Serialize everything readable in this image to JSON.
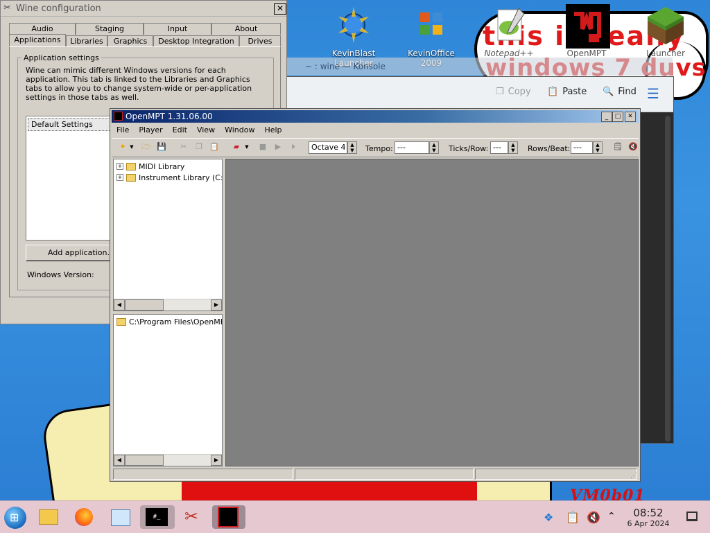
{
  "desktop": {
    "graffiti_top": "this is really",
    "graffiti_bottom": "windows 7 duvs",
    "corner_text": "VM0b01",
    "icons": [
      {
        "name": "KevinBlast Launcher",
        "label": "KevinBlast Launcher"
      },
      {
        "name": "KevinOffice 2009",
        "label": "KevinOffice 2009"
      },
      {
        "name": "Notepad++",
        "label": "Notepad++"
      },
      {
        "name": "OpenMPT",
        "label": "OpenMPT"
      },
      {
        "name": "Launcher",
        "label": "Launcher"
      }
    ]
  },
  "konsole": {
    "title": "~ : wine — Konsole",
    "copy": "Copy",
    "paste": "Paste",
    "find": "Find"
  },
  "wine": {
    "title": "Wine configuration",
    "close": "✕",
    "tabs_row1": [
      "Audio",
      "Staging",
      "Input",
      "About"
    ],
    "tabs_row2": [
      "Applications",
      "Libraries",
      "Graphics",
      "Desktop Integration",
      "Drives"
    ],
    "group_label": "Application settings",
    "description": "Wine can mimic different Windows versions for each application. This tab is linked to the Libraries and Graphics tabs to allow you to change system-wide or per-application settings in those tabs as well.",
    "list_item": "Default Settings",
    "add_button": "Add application...",
    "version_label": "Windows Version:"
  },
  "openmpt": {
    "title": "OpenMPT 1.31.06.00",
    "menus": [
      "File",
      "Player",
      "Edit",
      "View",
      "Window",
      "Help"
    ],
    "octave": "Octave 4",
    "tempo_label": "Tempo:",
    "tempo_value": "---",
    "ticks_label": "Ticks/Row:",
    "ticks_value": "---",
    "rows_label": "Rows/Beat:",
    "rows_value": "---",
    "tree_items": [
      "MIDI Library",
      "Instrument Library (C:\\P"
    ],
    "path_item": "C:\\Program Files\\OpenMPT\\"
  },
  "taskbar": {
    "time": "08:52",
    "date": "6 Apr 2024"
  },
  "colors": {
    "desktop_bg": "#2f86d8",
    "taskbar_bg": "#e6c8d0",
    "title_active": "#0a246a",
    "graffiti_red": "#e01a1a"
  }
}
